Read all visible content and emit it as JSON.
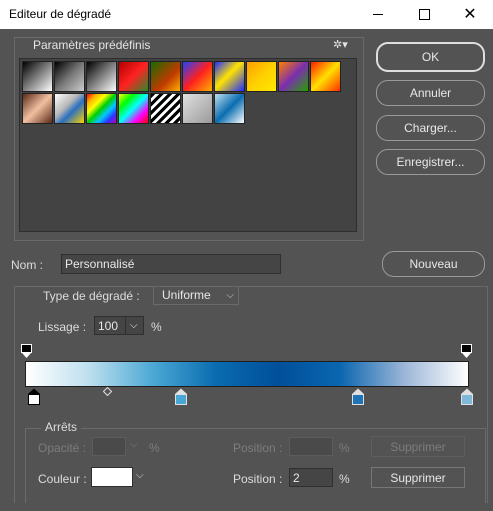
{
  "window": {
    "title": "Editeur de dégradé"
  },
  "presets": {
    "label": "Paramètres prédéfinis",
    "gear_icon": "gear-icon",
    "swatches": [
      "linear-gradient(135deg,#000 0%,#fff 100%)",
      "linear-gradient(135deg,#000 0%,#777 50%,#ccc 100%)",
      "linear-gradient(135deg,#000 0%,#fff 100%)",
      "linear-gradient(135deg,#b30000 0%,#ff2222 50%,#2a8a2a 100%)",
      "linear-gradient(135deg,#1a6a00 0%,#c03a00 60%,#ffb000 100%)",
      "linear-gradient(135deg,#2440ff 0%,#ff2020 50%,#ffb000 100%)",
      "linear-gradient(135deg,#1e2cff 0%,#ffe400 45%,#1e2cff 100%)",
      "linear-gradient(135deg,#ff9d00 0%,#ffd000 50%,#ffe800 100%)",
      "linear-gradient(135deg,#ff7d00 0%,#7a2fb0 50%,#26a000 100%)",
      "linear-gradient(135deg,#ff1e00 0%,#ffe000 50%,#ff2e00 100%)",
      "linear-gradient(135deg,#5a2a1a 0%,#f2c0a0 50%,#5a2a1a 100%)",
      "linear-gradient(135deg,#ffffff 0%,#b8b8b8 40%,#2a6fc0 60%,#ffd300 100%)",
      "linear-gradient(135deg,#ff0000,#ffb000,#ffff00,#00d000,#00c8ff,#3030ff,#c000c0)",
      "linear-gradient(135deg,#ffff00,#00ff00,#00ffff,#ff00ff,#ff0000)",
      "repeating-linear-gradient(135deg,#000 0 3px,#fff 3px 6px)",
      "linear-gradient(135deg,#e0e0e0 0%,#9a9a9a 100%)",
      "linear-gradient(135deg,#bfe0ef 0%,#0a6cb0 50%,#ffffff 100%)"
    ]
  },
  "buttons": {
    "ok": "OK",
    "annuler": "Annuler",
    "charger": "Charger...",
    "enregistrer": "Enregistrer...",
    "nouveau": "Nouveau"
  },
  "name_row": {
    "label": "Nom :",
    "value": "Personnalisé"
  },
  "gradient": {
    "type_label": "Type de dégradé :",
    "type_value": "Uniforme",
    "smoothness_label": "Lissage :",
    "smoothness_value": "100",
    "smoothness_unit": "%",
    "colors": [
      "#ffffff",
      "#bfe0ef",
      "#4aa7d4",
      "#0a6cb0",
      "#004f9a",
      "#0b66b0",
      "#9fb8d8",
      "#ffffff"
    ]
  },
  "stops": {
    "group_label": "Arrêts",
    "opacity_label": "Opacité :",
    "opacity_unit": "%",
    "opacity_position_label": "Position :",
    "opacity_position_unit": "%",
    "delete_opacity": "Supprimer",
    "color_label": "Couleur :",
    "color_value": "#ffffff",
    "color_position_label": "Position :",
    "color_position_value": "2",
    "color_position_unit": "%",
    "delete_color": "Supprimer"
  }
}
